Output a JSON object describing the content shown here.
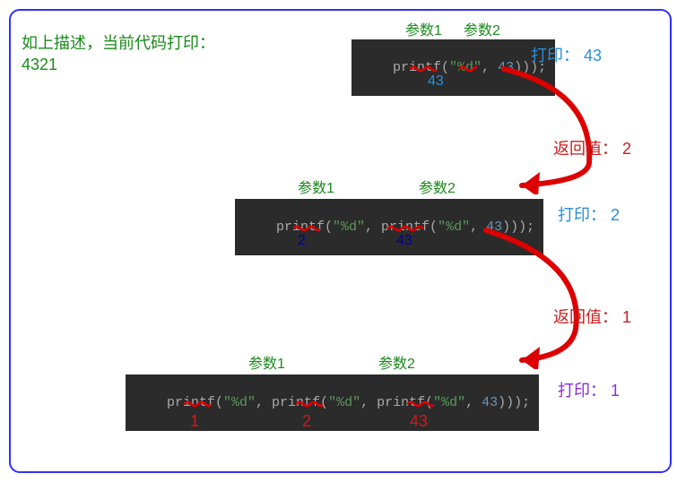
{
  "description": {
    "line1": "如上描述，当前代码打印：",
    "line2": "4321"
  },
  "step1": {
    "param1_label": "参数1",
    "param2_label": "参数2",
    "code_pre": "printf(",
    "code_str": "\"%d\"",
    "code_mid": ", ",
    "code_num": "43",
    "code_post": ")));",
    "below_val": "43",
    "print_label": "打印：",
    "print_val": "43",
    "return_label": "返回值：",
    "return_val": "2"
  },
  "step2": {
    "param1_label": "参数1",
    "param2_label": "参数2",
    "code_pre": "printf(",
    "code_str1": "\"%d\"",
    "code_mid1": ", printf(",
    "code_str2": "\"%d\"",
    "code_mid2": ", ",
    "code_num": "43",
    "code_post": ")));",
    "below_val1": "2",
    "below_val2": "43",
    "print_label": "打印：",
    "print_val": "2",
    "return_label": "返回值：",
    "return_val": "1"
  },
  "step3": {
    "param1_label": "参数1",
    "param2_label": "参数2",
    "code_pre": "printf(",
    "code_str1": "\"%d\"",
    "code_mid1": ", printf(",
    "code_str2": "\"%d\"",
    "code_mid2": ", printf(",
    "code_str3": "\"%d\"",
    "code_mid3": ", ",
    "code_num": "43",
    "code_post": ")));",
    "below_val1": "1",
    "below_val2": "2",
    "below_val3": "43",
    "print_label": "打印：",
    "print_val": "1"
  }
}
